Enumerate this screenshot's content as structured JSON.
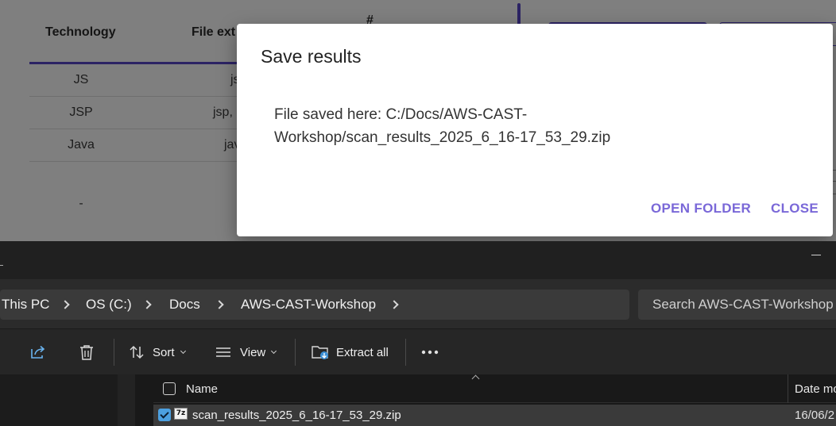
{
  "webapp": {
    "table_headers": {
      "technology": "Technology",
      "file_extensions": "File ext",
      "count": "#"
    },
    "rows": [
      {
        "technology": "JS",
        "extensions": "js"
      },
      {
        "technology": "JSP",
        "extensions": "jsp,"
      },
      {
        "technology": "Java",
        "extensions": "jav"
      },
      {
        "technology": "-",
        "extensions": ""
      }
    ],
    "accent_color": "#5846c8"
  },
  "dialog": {
    "title": "Save results",
    "message": "File saved here: C:/Docs/AWS-CAST-Workshop/scan_results_2025_6_16-17_53_29.zip",
    "open_folder_label": "OPEN FOLDER",
    "close_label": "CLOSE",
    "button_color": "#7a68d8"
  },
  "explorer": {
    "breadcrumb": [
      "This PC",
      "OS (C:)",
      "Docs",
      "AWS-CAST-Workshop"
    ],
    "search_placeholder": "Search AWS-CAST-Workshop",
    "toolbar": {
      "share_icon": "share-icon",
      "delete_icon": "trash-icon",
      "sort_label": "Sort",
      "view_label": "View",
      "extract_all_label": "Extract all",
      "more_icon": "more-icon"
    },
    "columns": {
      "name": "Name",
      "date_modified": "Date mo"
    },
    "files": [
      {
        "icon": "7z-icon",
        "icon_text": "7z",
        "name": "scan_results_2025_6_16-17_53_29.zip",
        "date": "16/06/2",
        "selected": true
      }
    ]
  }
}
